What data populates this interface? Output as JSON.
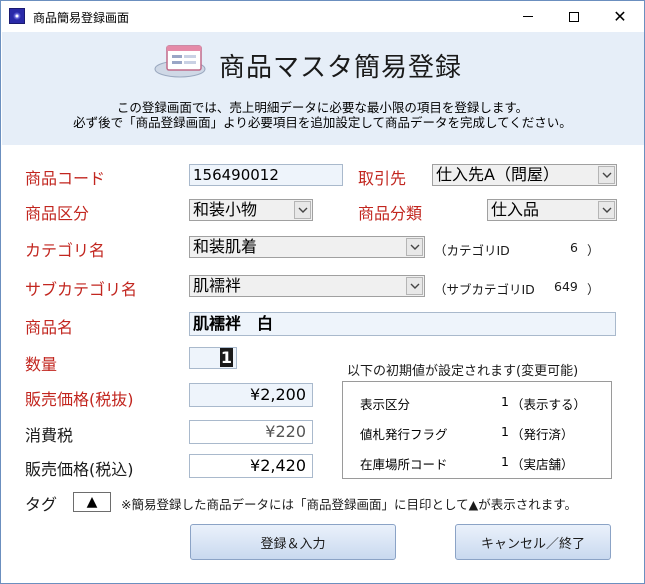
{
  "window": {
    "title": "商品簡易登録画面"
  },
  "header": {
    "title": "商品マスタ簡易登録",
    "description_line1": "この登録画面では、売上明細データに必要な最小限の項目を登録します。",
    "description_line2": "必ず後で「商品登録画面」より必要項目を追加設定して商品データを完成してください。"
  },
  "form": {
    "product_code": {
      "label": "商品コード",
      "value": "156490012"
    },
    "supplier": {
      "label": "取引先",
      "value": "仕入先A（問屋）"
    },
    "product_kubun": {
      "label": "商品区分",
      "value": "和装小物"
    },
    "product_bunrui": {
      "label": "商品分類",
      "value": "仕入品"
    },
    "category": {
      "label": "カテゴリ名",
      "value": "和装肌着",
      "id_label": "（カテゴリID",
      "id_value": "6",
      "id_close": "）"
    },
    "subcategory": {
      "label": "サブカテゴリ名",
      "value": "肌襦袢",
      "id_label": "（サブカテゴリID",
      "id_value": "649",
      "id_close": "）"
    },
    "product_name": {
      "label": "商品名",
      "value": "肌襦袢　白"
    },
    "quantity": {
      "label": "数量",
      "value": "1"
    },
    "price_excl": {
      "label": "販売価格(税抜)",
      "value": "¥2,200"
    },
    "tax": {
      "label": "消費税",
      "value": "¥220"
    },
    "price_incl": {
      "label": "販売価格(税込)",
      "value": "¥2,420"
    }
  },
  "defaults": {
    "heading": "以下の初期値が設定されます(変更可能)",
    "rows": [
      {
        "label": "表示区分",
        "value": "1",
        "desc": "（表示する）"
      },
      {
        "label": "値札発行フラグ",
        "value": "1",
        "desc": "（発行済）"
      },
      {
        "label": "在庫場所コード",
        "value": "1",
        "desc": "（実店舗）"
      }
    ]
  },
  "tag": {
    "label": "タグ",
    "value": "▲",
    "note": "※簡易登録した商品データには「商品登録画面」に目印として▲が表示されます。"
  },
  "buttons": {
    "register": "登録＆入力",
    "cancel": "キャンセル／終了"
  },
  "colors": {
    "required_label": "#c2261f",
    "header_band": "#e6eef8",
    "field_bg": "#eef4fb"
  }
}
